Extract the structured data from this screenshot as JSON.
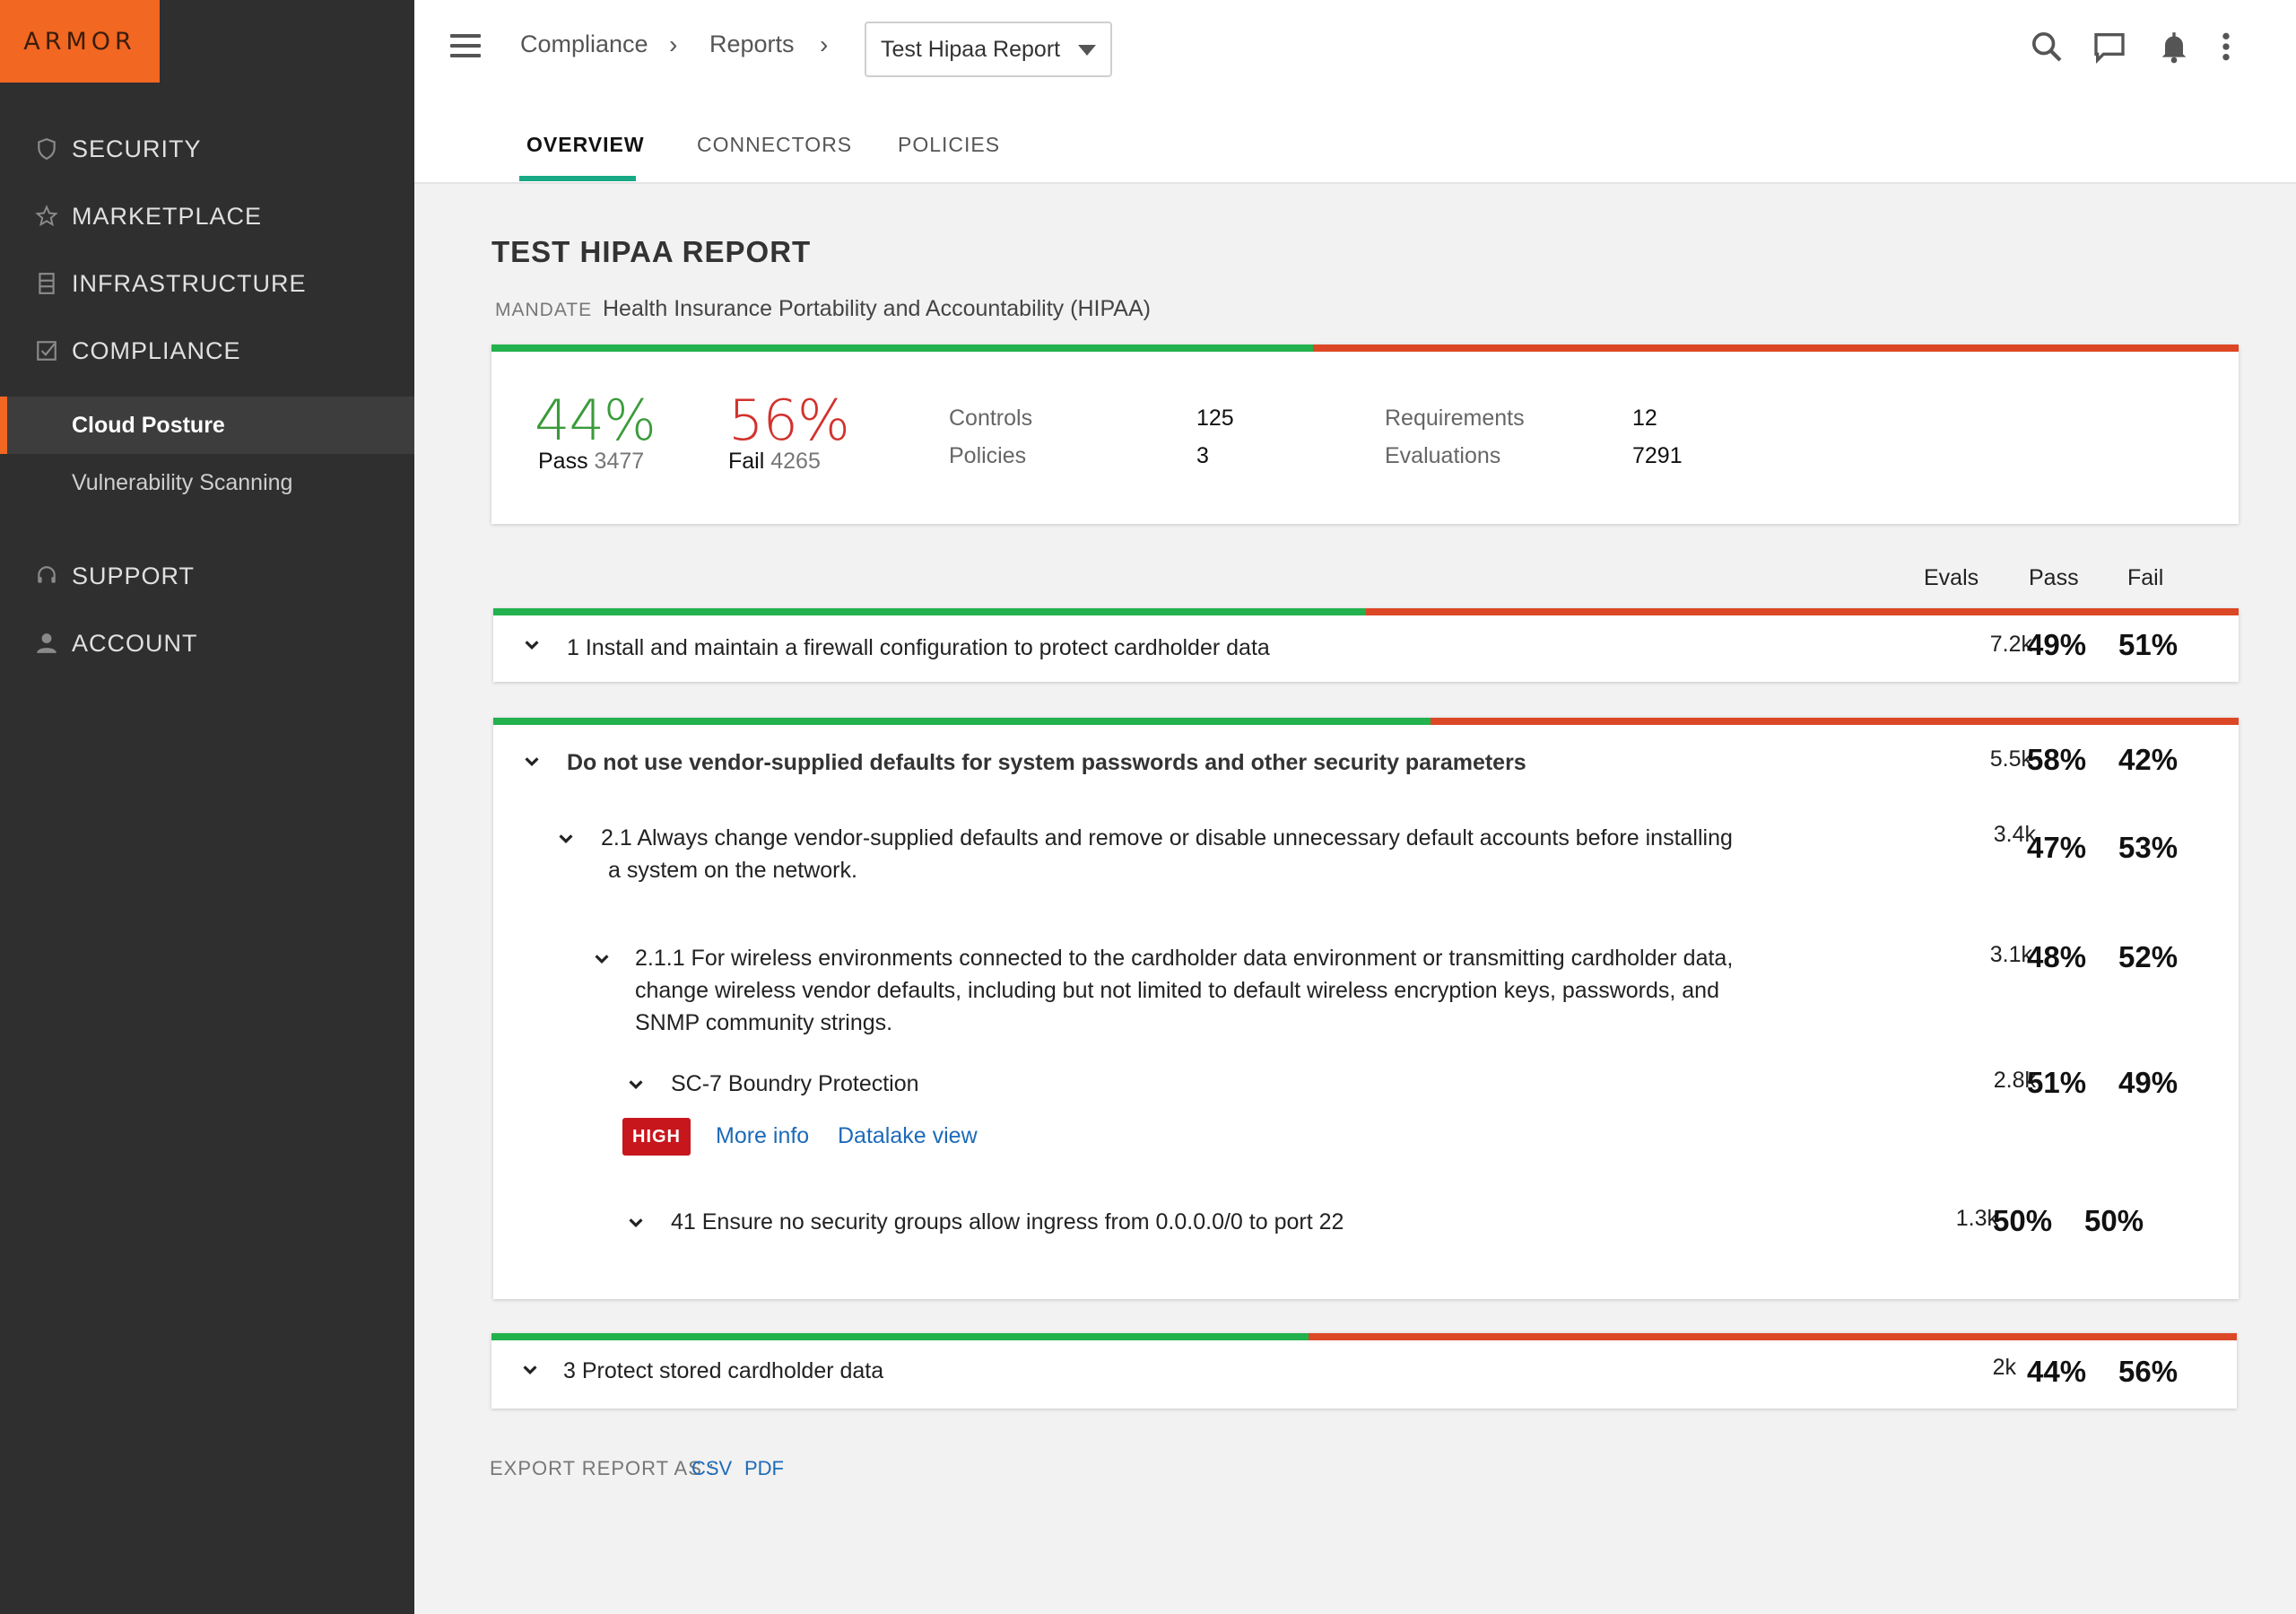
{
  "brand": {
    "logo_text": "ARMOR",
    "accent": "#f26722"
  },
  "sidebar": {
    "items": [
      {
        "label": "SECURITY",
        "icon": "shield-icon"
      },
      {
        "label": "MARKETPLACE",
        "icon": "star-icon"
      },
      {
        "label": "INFRASTRUCTURE",
        "icon": "server-icon"
      },
      {
        "label": "COMPLIANCE",
        "icon": "checkbox-icon"
      }
    ],
    "sub_items": [
      {
        "label": "Cloud Posture",
        "active": true
      },
      {
        "label": "Vulnerability Scanning",
        "active": false
      }
    ],
    "bottom_items": [
      {
        "label": "SUPPORT",
        "icon": "headset-icon"
      },
      {
        "label": "ACCOUNT",
        "icon": "person-icon"
      }
    ]
  },
  "header": {
    "breadcrumb": [
      "Compliance",
      "Reports"
    ],
    "report_select": "Test Hipaa Report",
    "icons": [
      "search-icon",
      "chat-icon",
      "bell-icon",
      "more-vert-icon"
    ]
  },
  "tabs": [
    {
      "label": "OVERVIEW",
      "active": true
    },
    {
      "label": "CONNECTORS",
      "active": false
    },
    {
      "label": "POLICIES",
      "active": false
    }
  ],
  "report": {
    "title": "TEST HIPAA REPORT",
    "mandate_label": "MANDATE",
    "mandate_value": "Health Insurance Portability and Accountability (HIPAA)"
  },
  "summary": {
    "pass_pct": "44%",
    "pass_label": "Pass",
    "pass_count": "3477",
    "fail_pct": "56%",
    "fail_label": "Fail",
    "fail_count": "4265",
    "pass_ratio": 0.47,
    "stats": [
      {
        "label": "Controls",
        "value": "125"
      },
      {
        "label": "Policies",
        "value": "3"
      },
      {
        "label": "Requirements",
        "value": "12"
      },
      {
        "label": "Evaluations",
        "value": "7291"
      }
    ],
    "pass_color": "#3a9b3a",
    "fail_color": "#d2322d"
  },
  "columns": {
    "evals": "Evals",
    "pass": "Pass",
    "fail": "Fail"
  },
  "rows": {
    "r1": {
      "text": "1 Install and maintain a firewall configuration to protect cardholder data",
      "evals": "7.2k",
      "pass": "49%",
      "fail": "51%",
      "pass_ratio": 0.5
    },
    "r2": {
      "text": "Do not use vendor-supplied defaults for system passwords and other security parameters",
      "evals": "5.5k",
      "pass": "58%",
      "fail": "42%",
      "pass_ratio": 0.537
    },
    "r2_1": {
      "text_line1": "2.1 Always change vendor-supplied defaults and remove or disable unnecessary default accounts before installing",
      "text_line2": "a system on the network.",
      "evals": "3.4k",
      "pass": "47%",
      "fail": "53%"
    },
    "r2_1_1": {
      "text_line1": "2.1.1 For wireless environments connected to the cardholder data environment or transmitting cardholder data,",
      "text_line2": "change wireless vendor defaults, including but not limited to default wireless encryption keys, passwords, and",
      "text_line3": "SNMP community strings.",
      "evals": "3.1k",
      "pass": "48%",
      "fail": "52%"
    },
    "sc7": {
      "text": "SC-7 Boundry Protection",
      "evals": "2.8k",
      "pass": "51%",
      "fail": "49%",
      "badge": "HIGH",
      "more_info": "More info",
      "datalake": "Datalake view"
    },
    "p41": {
      "text": "41 Ensure no security groups allow ingress from 0.0.0.0/0 to port 22",
      "evals": "1.3k",
      "pass": "50%",
      "fail": "50%"
    },
    "r3": {
      "text": "3 Protect stored cardholder data",
      "evals": "2k",
      "pass": "44%",
      "fail": "56%",
      "pass_ratio": 0.468
    }
  },
  "export": {
    "label": "EXPORT REPORT AS :",
    "csv": "CSV",
    "pdf": "PDF"
  }
}
